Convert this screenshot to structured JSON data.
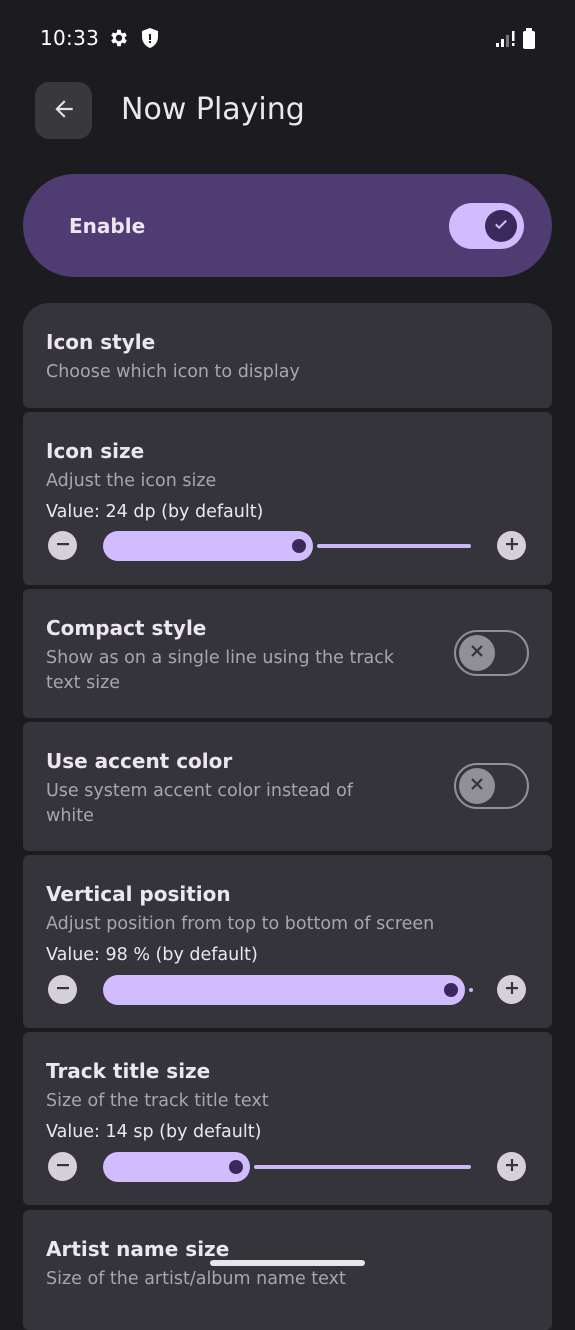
{
  "status_bar": {
    "time": "10:33",
    "icons": [
      "gear-icon",
      "shield-icon",
      "signal-icon",
      "battery-icon"
    ]
  },
  "top_bar": {
    "title": "Now Playing",
    "back_icon": "arrow-back-icon"
  },
  "enable": {
    "label": "Enable",
    "checked": true
  },
  "settings": {
    "icon_style": {
      "title": "Icon style",
      "subtitle": "Choose which icon to display"
    },
    "icon_size": {
      "title": "Icon size",
      "subtitle": "Adjust the icon size",
      "value": "Value: 24 dp (by default)",
      "fraction": 0.55
    },
    "compact_style": {
      "title": "Compact style",
      "subtitle_line1": "Show as on a single line using the track",
      "subtitle_line2": "text size",
      "checked": false
    },
    "accent_color": {
      "title": "Use accent color",
      "subtitle_line1": "Use system accent color instead of",
      "subtitle_line2": "white",
      "checked": false
    },
    "vertical_position": {
      "title": "Vertical position",
      "subtitle": "Adjust position from top to bottom of screen",
      "value": "Value: 98 % (by default)",
      "fraction": 0.98
    },
    "track_title_size": {
      "title": "Track title size",
      "subtitle": "Size of the track title text",
      "value": "Value: 14 sp (by default)",
      "fraction": 0.38
    },
    "artist_name_size": {
      "title": "Artist name size",
      "subtitle": "Size of the artist/album name text"
    }
  },
  "colors": {
    "background": "#1c1b1f",
    "accent": "#d0bcff",
    "enable_card": "#4f3c72",
    "card": "#36343b"
  }
}
